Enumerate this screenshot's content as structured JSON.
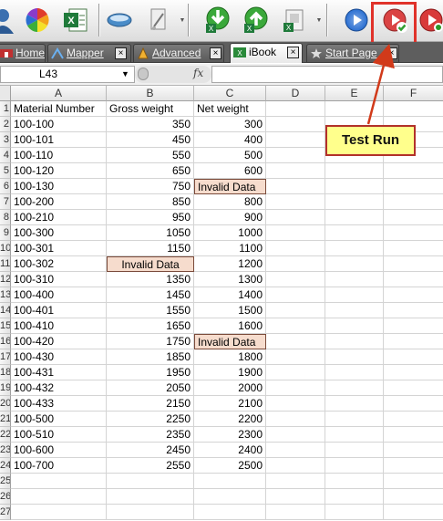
{
  "toolbar": {
    "buttons": [
      {
        "name": "user-icon"
      },
      {
        "name": "color-palette-icon"
      },
      {
        "name": "excel-icon"
      },
      {
        "name": "database-icon"
      },
      {
        "name": "document-icon"
      },
      {
        "name": "import-green-icon"
      },
      {
        "name": "export-green-icon"
      },
      {
        "name": "excel-sheet-icon"
      },
      {
        "name": "run-blue-icon"
      },
      {
        "name": "test-run-icon"
      },
      {
        "name": "run-red-icon"
      }
    ],
    "accent": "#e0322a"
  },
  "tabs": [
    {
      "label": "Home",
      "icon": "home-icon",
      "active": false
    },
    {
      "label": "Mapper",
      "icon": "mapper-icon",
      "active": false
    },
    {
      "label": "Advanced",
      "icon": "advanced-icon",
      "active": false
    },
    {
      "label": "iBook",
      "icon": "ibook-icon",
      "active": true
    },
    {
      "label": "Start Page",
      "icon": "start-page-icon",
      "active": false
    }
  ],
  "formula_bar": {
    "cell_ref": "L43",
    "fx": "fx",
    "formula": ""
  },
  "grid": {
    "columns": [
      "A",
      "B",
      "C",
      "D",
      "E",
      "F"
    ],
    "headers": [
      "Material Number",
      "Gross weight",
      "Net weight"
    ],
    "rows": [
      [
        "100-100",
        "350",
        "300"
      ],
      [
        "100-101",
        "450",
        "400"
      ],
      [
        "100-110",
        "550",
        "500"
      ],
      [
        "100-120",
        "650",
        "600"
      ],
      [
        "100-130",
        "750",
        "Invalid Data"
      ],
      [
        "100-200",
        "850",
        "800"
      ],
      [
        "100-210",
        "950",
        "900"
      ],
      [
        "100-300",
        "1050",
        "1000"
      ],
      [
        "100-301",
        "1150",
        "1100"
      ],
      [
        "100-302",
        "Invalid Data",
        "1200"
      ],
      [
        "100-310",
        "1350",
        "1300"
      ],
      [
        "100-400",
        "1450",
        "1400"
      ],
      [
        "100-401",
        "1550",
        "1500"
      ],
      [
        "100-410",
        "1650",
        "1600"
      ],
      [
        "100-420",
        "1750",
        "Invalid Data"
      ],
      [
        "100-430",
        "1850",
        "1800"
      ],
      [
        "100-431",
        "1950",
        "1900"
      ],
      [
        "100-432",
        "2050",
        "2000"
      ],
      [
        "100-433",
        "2150",
        "2100"
      ],
      [
        "100-500",
        "2250",
        "2200"
      ],
      [
        "100-510",
        "2350",
        "2300"
      ],
      [
        "100-600",
        "2450",
        "2400"
      ],
      [
        "100-700",
        "2550",
        "2500"
      ]
    ],
    "row_numbers": [
      "1",
      "2",
      "3",
      "4",
      "5",
      "6",
      "7",
      "8",
      "9",
      "10",
      "11",
      "12",
      "13",
      "14",
      "15",
      "16",
      "17",
      "18",
      "19",
      "20",
      "21",
      "22",
      "23",
      "24",
      "25",
      "26",
      "27"
    ],
    "invalid_color": "#f6dccd"
  },
  "callout": {
    "text": "Test Run",
    "background": "#ffff8c",
    "border": "#b2312a"
  }
}
